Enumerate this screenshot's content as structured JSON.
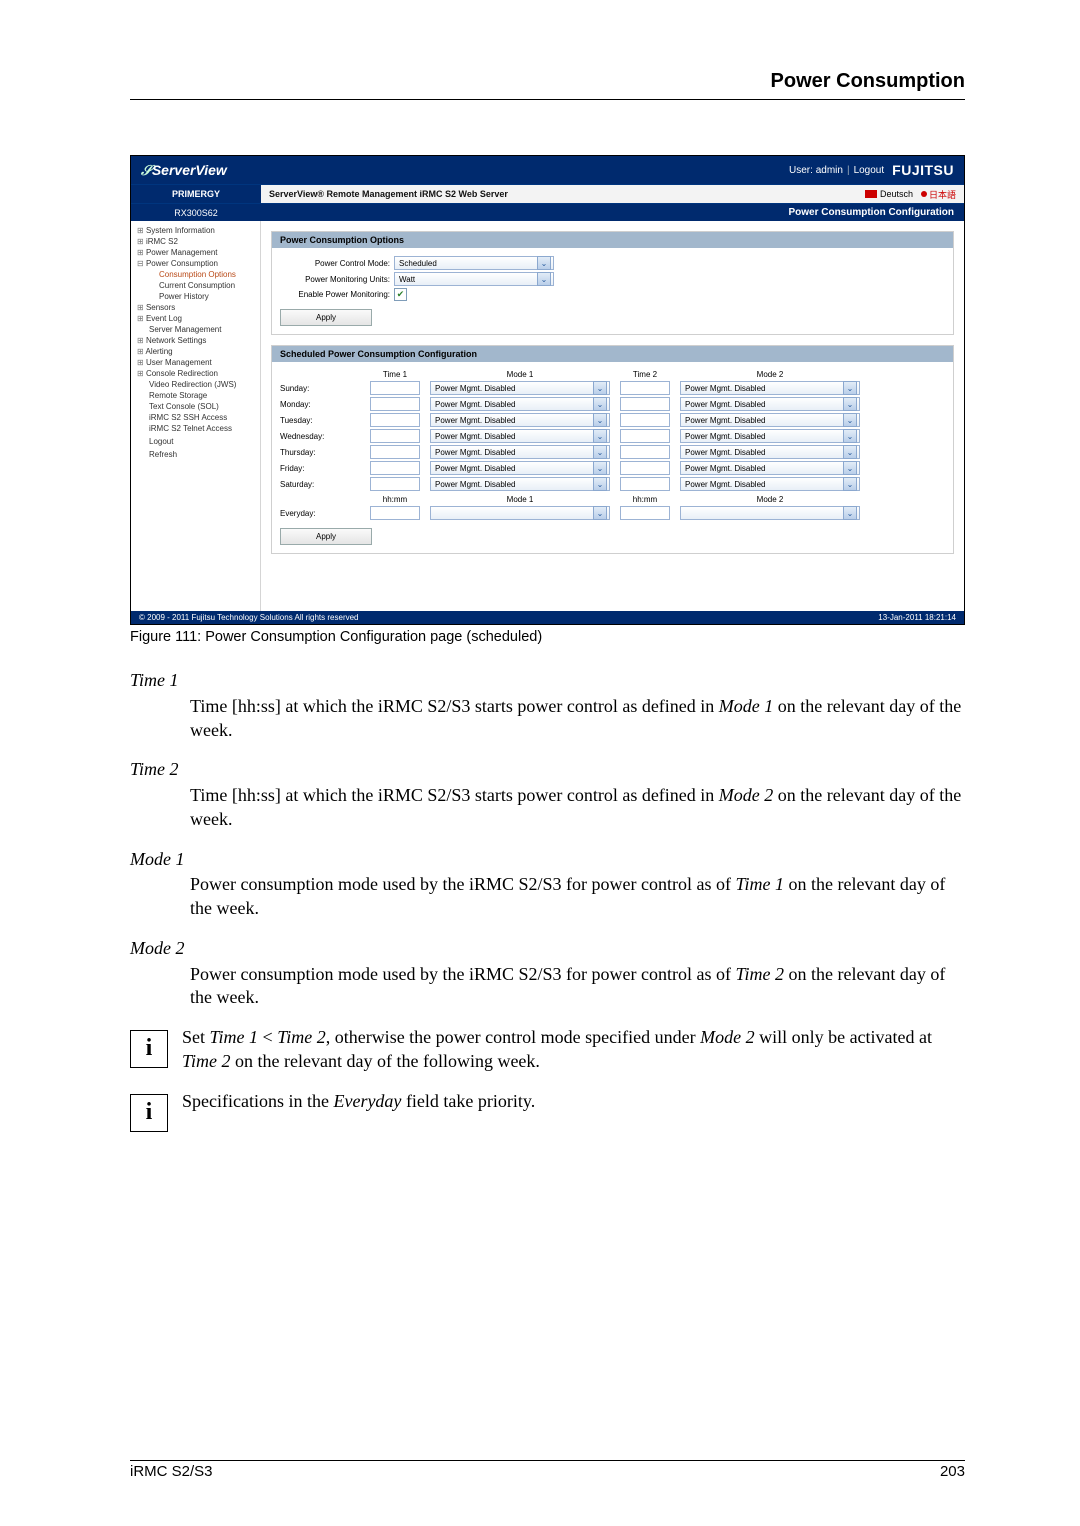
{
  "header": {
    "title": "Power Consumption"
  },
  "figure": {
    "caption": "Figure 111: Power Consumption Configuration page (scheduled)",
    "topbar": {
      "brand": "ServerView",
      "user_prefix": "User:",
      "user": "admin",
      "logout": "Logout",
      "vendor": "FUJITSU"
    },
    "sub1": {
      "left": "PRIMERGY",
      "mid": "ServerView® Remote Management iRMC S2 Web Server",
      "de": "Deutsch",
      "jp": "日本語"
    },
    "sub2": {
      "left": "RX300S62",
      "right": "Power Consumption Configuration"
    },
    "nav": {
      "items": [
        {
          "cls": "top",
          "t": "System Information"
        },
        {
          "cls": "top",
          "t": "iRMC S2"
        },
        {
          "cls": "top",
          "t": "Power Management"
        },
        {
          "cls": "top-minus",
          "t": "Power Consumption"
        },
        {
          "cls": "ind4 active",
          "t": "Consumption Options"
        },
        {
          "cls": "ind4",
          "t": "Current Consumption"
        },
        {
          "cls": "ind4",
          "t": "Power History"
        },
        {
          "cls": "top",
          "t": "Sensors"
        },
        {
          "cls": "top",
          "t": "Event Log"
        },
        {
          "cls": "ind",
          "t": "Server Management"
        },
        {
          "cls": "top",
          "t": "Network Settings"
        },
        {
          "cls": "top",
          "t": "Alerting"
        },
        {
          "cls": "top",
          "t": "User Management"
        },
        {
          "cls": "top",
          "t": "Console Redirection"
        },
        {
          "cls": "ind",
          "t": "Video Redirection (JWS)"
        },
        {
          "cls": "ind",
          "t": "Remote Storage"
        },
        {
          "cls": "ind",
          "t": "Text Console (SOL)"
        },
        {
          "cls": "ind",
          "t": "iRMC S2 SSH Access"
        },
        {
          "cls": "ind",
          "t": "iRMC S2 Telnet Access"
        },
        {
          "cls": "ind",
          "t": " "
        },
        {
          "cls": "ind",
          "t": "Logout"
        },
        {
          "cls": "ind",
          "t": " "
        },
        {
          "cls": "ind",
          "t": "Refresh"
        }
      ]
    },
    "panel1": {
      "title": "Power Consumption Options",
      "rows": {
        "r0": {
          "lbl": "Power Control Mode:",
          "val": "Scheduled"
        },
        "r1": {
          "lbl": "Power Monitoring Units:",
          "val": "Watt"
        },
        "r2": {
          "lbl": "Enable Power Monitoring:"
        }
      },
      "apply": "Apply"
    },
    "panel2": {
      "title": "Scheduled Power Consumption Configuration",
      "head": {
        "c1": "Time 1",
        "c2": "Mode 1",
        "c3": "Time 2",
        "c4": "Mode 2"
      },
      "days": [
        "Sunday:",
        "Monday:",
        "Tuesday:",
        "Wednesday:",
        "Thursday:",
        "Friday:",
        "Saturday:"
      ],
      "mode_val": "Power Mgmt. Disabled",
      "every_head": {
        "c1": "hh:mm",
        "c2": "Mode 1",
        "c3": "hh:mm",
        "c4": "Mode 2"
      },
      "every_label": "Everyday:",
      "apply": "Apply"
    },
    "bottom": {
      "copy": "© 2009 - 2011 Fujitsu Technology Solutions All rights reserved",
      "ts": "13-Jan-2011 18:21:14"
    }
  },
  "doc": {
    "t1": {
      "term": "Time 1",
      "d1": "Time [hh:ss] at which the iRMC S2/S3 starts power control as defined in ",
      "d2": "Mode 1",
      "d3": " on the relevant day of the week."
    },
    "t2": {
      "term": "Time 2",
      "d1": "Time [hh:ss] at which the iRMC S2/S3 starts power control as defined in ",
      "d2": "Mode 2",
      "d3": " on the relevant day of the week."
    },
    "m1": {
      "term": "Mode 1",
      "d1": "Power consumption mode used by the iRMC S2/S3 for power control as of ",
      "d2": "Time 1",
      "d3": " on the relevant day of the week."
    },
    "m2": {
      "term": "Mode 2",
      "d1": "Power consumption mode used by the iRMC S2/S3 for power control as of ",
      "d2": "Time 2",
      "d3": " on the relevant day of the week."
    },
    "info1": {
      "a": "Set ",
      "b": "Time 1",
      "c": " < ",
      "d": "Time 2",
      "e": ", otherwise the power control mode specified under ",
      "f": "Mode 2",
      "g": " will only be activated at ",
      "h": "Time 2",
      "i": " on the relevant day of the following week."
    },
    "info2": {
      "a": "Specifications in the ",
      "b": "Everyday",
      "c": " field take priority."
    }
  },
  "footer": {
    "left": "iRMC S2/S3",
    "right": "203"
  }
}
